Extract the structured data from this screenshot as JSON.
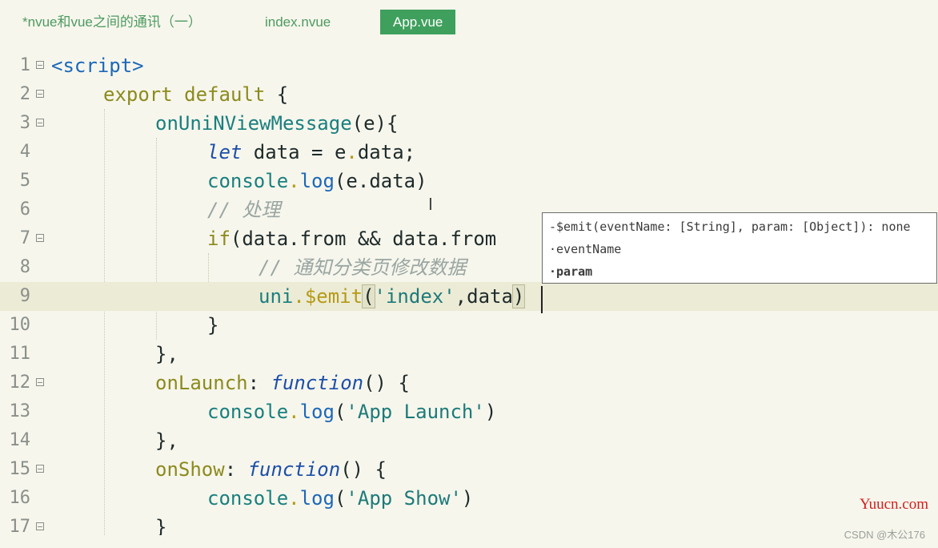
{
  "tabs": [
    {
      "label": "*nvue和vue之间的通讯（一）",
      "active": false
    },
    {
      "label": "index.nvue",
      "active": false
    },
    {
      "label": "App.vue",
      "active": true
    }
  ],
  "editor": {
    "current_line": 9,
    "lines": [
      {
        "n": "1"
      },
      {
        "n": "2"
      },
      {
        "n": "3"
      },
      {
        "n": "4"
      },
      {
        "n": "5"
      },
      {
        "n": "6"
      },
      {
        "n": "7"
      },
      {
        "n": "8"
      },
      {
        "n": "9"
      },
      {
        "n": "10"
      },
      {
        "n": "11"
      },
      {
        "n": "12"
      },
      {
        "n": "13"
      },
      {
        "n": "14"
      },
      {
        "n": "15"
      },
      {
        "n": "16"
      },
      {
        "n": "17"
      }
    ],
    "tokens": {
      "l1_tag": "<script>",
      "l2_kw": "export default",
      "l2_brace": " {",
      "l3_fn": "onUniNViewMessage",
      "l3_rest": "(e){",
      "l4_let": "let",
      "l4_rest1": " data = e",
      "l4_dot": ".",
      "l4_rest2": "data;",
      "l5_obj": "console",
      "l5_dot": ".",
      "l5_fn": "log",
      "l5_rest": "(e.data)",
      "l6_com": "// 处理",
      "l7_if": "if",
      "l7_rest": "(data.from && data.from",
      "l8_com": "// 通知分类页修改数据",
      "l9_obj": "uni",
      "l9_dot": ".",
      "l9_fn": "$emit",
      "l9_open": "(",
      "l9_str": "'index'",
      "l9_rest": ",data",
      "l9_close": ")",
      "l10": "}",
      "l11": "},",
      "l12_prop": "onLaunch",
      "l12_colon": ": ",
      "l12_func": "function",
      "l12_rest": "() {",
      "l13_obj": "console",
      "l13_dot": ".",
      "l13_fn": "log",
      "l13_open": "(",
      "l13_str": "'App Launch'",
      "l13_close": ")",
      "l14": "},",
      "l15_prop": "onShow",
      "l15_colon": ": ",
      "l15_func": "function",
      "l15_rest": "() {",
      "l16_obj": "console",
      "l16_dot": ".",
      "l16_fn": "log",
      "l16_open": "(",
      "l16_str": "'App Show'",
      "l16_close": ")",
      "l17": "}"
    }
  },
  "hint": {
    "signature": "-$emit(eventName: [String], param: [Object]): none",
    "param1": "·eventName",
    "param2": "·param"
  },
  "watermarks": {
    "site": "Yuucn.com",
    "csdn": "CSDN @木公176"
  },
  "colors": {
    "background": "#f6f6ec",
    "active_tab": "#3fa05d",
    "keyword": "#8c8a1e",
    "tag": "#1d67b8",
    "string": "#1d7a7a",
    "comment": "#9aa6a2"
  }
}
